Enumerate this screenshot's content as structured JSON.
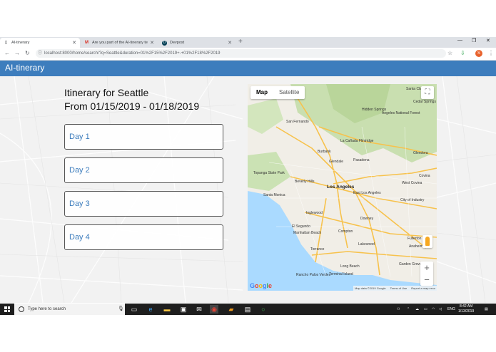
{
  "browser": {
    "tabs": [
      {
        "title": "AI-tinerary",
        "favicon": "page-icon",
        "active": true
      },
      {
        "title": "Are you part of the AI-tinerary te",
        "favicon": "gmail-icon",
        "active": false
      },
      {
        "title": "Devpost",
        "favicon": "devpost-icon",
        "active": false
      }
    ],
    "url": "localhost:8000/home/search/?q=Seattle&duration=01%2F15%2F2019+-+01%2F18%2F2019",
    "profile_initial": "S"
  },
  "app": {
    "brand": "AI-tinerary",
    "brand_color": "#3d7dbd"
  },
  "itinerary": {
    "title": "Itinerary for Seattle",
    "dates": "From 01/15/2019 - 01/18/2019",
    "days": [
      "Day 1",
      "Day 2",
      "Day 3",
      "Day 4"
    ]
  },
  "map": {
    "type_options": [
      "Map",
      "Satellite"
    ],
    "selected_type": "Map",
    "zoom_in": "+",
    "zoom_out": "−",
    "footer": [
      "Map data ©2019 Google",
      "Terms of Use",
      "Report a map error"
    ],
    "labels": [
      "Hidden Springs",
      "Angeles National Forest",
      "Cedar Springs",
      "San Fernando",
      "La Cañada Flintridge",
      "Burbank",
      "Glendale",
      "Pasadena",
      "Topanga State Park",
      "Beverly Hills",
      "Los Angeles",
      "West Covina",
      "Santa Monica",
      "East Los Angeles",
      "Inglewood",
      "El Segundo",
      "Manhattan Beach",
      "Downey",
      "Compton",
      "Torrance",
      "Lakewood",
      "Long Beach",
      "Fullerton",
      "Anaheim",
      "Rancho Palos Verdes",
      "Terminal Island",
      "Garden Grove",
      "Covina",
      "City of Industry",
      "Glendora",
      "Santa Clarita"
    ]
  },
  "taskbar": {
    "search_placeholder": "Type here to search",
    "time": "8:42 AM",
    "date": "1/13/2019",
    "language": "ENG"
  }
}
